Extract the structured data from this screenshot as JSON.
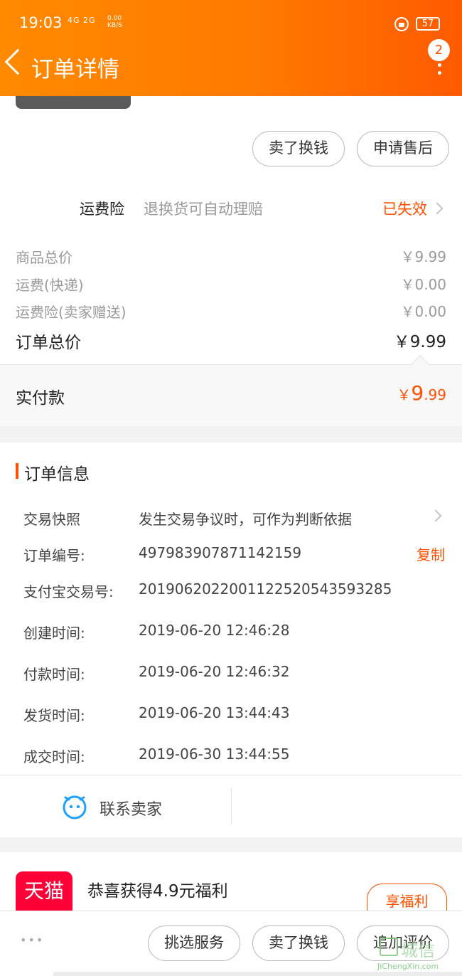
{
  "status_bar": {
    "time": "19:03",
    "signal": "4G  2G",
    "speed_line1": "0.00",
    "speed_line2": "KB/S",
    "battery": "57"
  },
  "header": {
    "title": "订单详情",
    "badge": "2",
    "icons": [
      "back-icon",
      "more-icon",
      "lock-icon",
      "battery-icon"
    ]
  },
  "actions_top": {
    "sell": "卖了换钱",
    "after_sale": "申请售后"
  },
  "insurance": {
    "label": "运费险",
    "desc": "退换货可自动理赔",
    "status": "已失效"
  },
  "prices": {
    "goods_label": "商品总价",
    "goods_value": "￥9.99",
    "shipping_label": "运费(快递)",
    "shipping_value": "￥0.00",
    "insurance_label": "运费险(卖家赠送)",
    "insurance_value": "￥0.00",
    "total_label": "订单总价",
    "total_value": "￥9.99",
    "paid_label": "实付款",
    "paid_currency": "￥",
    "paid_int": "9",
    "paid_dec": ".99"
  },
  "order_info": {
    "section_title": "订单信息",
    "snapshot_label": "交易快照",
    "snapshot_value": "发生交易争议时，可作为判断依据",
    "order_no_label": "订单编号:",
    "order_no_value": "497983907871142159",
    "copy": "复制",
    "alipay_label": "支付宝交易号:",
    "alipay_value": "2019062022001122520543593285",
    "created_label": "创建时间:",
    "created_value": "2019-06-20 12:46:28",
    "paid_label": "付款时间:",
    "paid_value": "2019-06-20 12:46:32",
    "shipped_label": "发货时间:",
    "shipped_value": "2019-06-20 13:44:43",
    "completed_label": "成交时间:",
    "completed_value": "2019-06-30 13:44:55"
  },
  "contact": {
    "label": "联系卖家"
  },
  "promo": {
    "logo": "天猫",
    "text": "恭喜获得4.9元福利",
    "button": "享福利"
  },
  "bottom_bar": {
    "more": "•••",
    "choose_service": "挑选服务",
    "sell": "卖了换钱",
    "add_review": "追加评价"
  },
  "watermark": {
    "site": "JiChengXin.com",
    "text": "城信"
  },
  "colors": {
    "accent": "#ff5000",
    "header_start": "#ff8a00",
    "header_end": "#ff5a00",
    "tmall_red": "#ff0036",
    "contact_blue": "#1ea0ff"
  }
}
